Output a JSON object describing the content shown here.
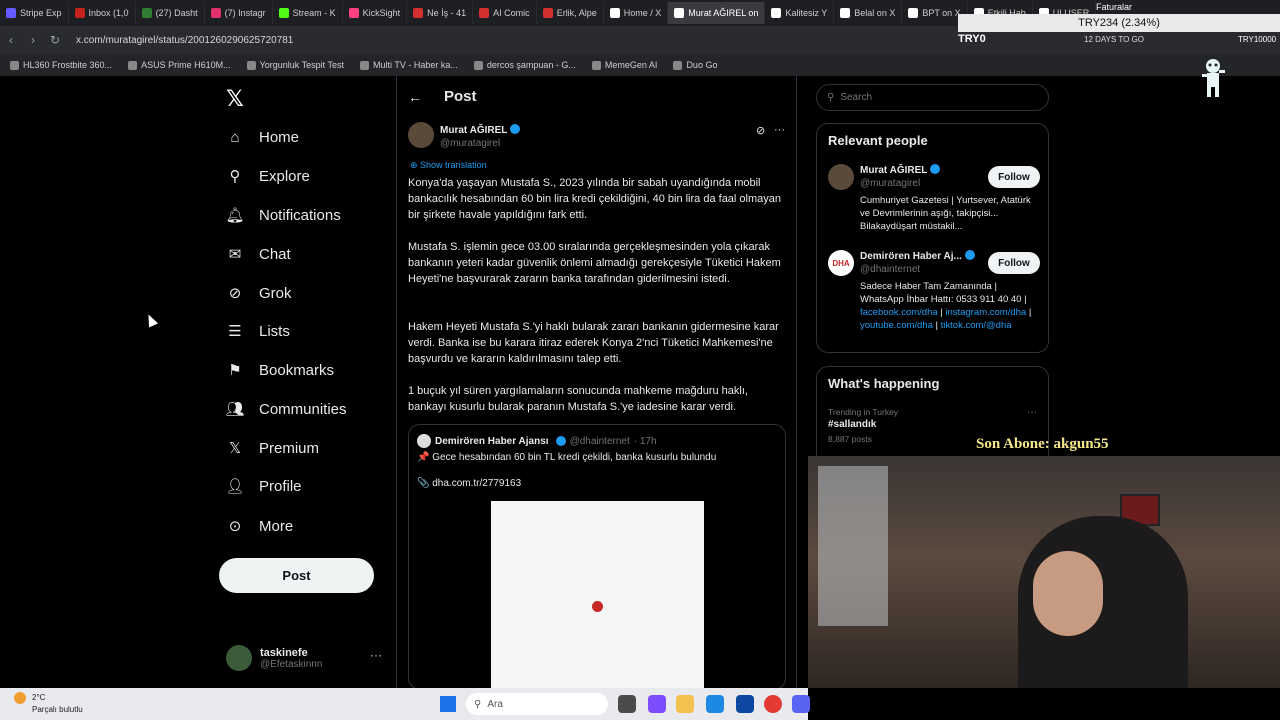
{
  "browser": {
    "tabs": [
      {
        "label": "Stripe Exp",
        "color": "#635bff"
      },
      {
        "label": "Inbox (1,0",
        "color": "#c5221f"
      },
      {
        "label": "(27) Dasht",
        "color": "#2e7d32"
      },
      {
        "label": "(7) Instagr",
        "color": "#e1306c"
      },
      {
        "label": "Stream - K",
        "color": "#53fc18"
      },
      {
        "label": "KickSight",
        "color": "#ff4081"
      },
      {
        "label": "Ne İş - 41",
        "color": "#d32f2f"
      },
      {
        "label": "AI Comic",
        "color": "#d32f2f"
      },
      {
        "label": "Erlik, Alpe",
        "color": "#d32f2f"
      },
      {
        "label": "Home / X",
        "color": "#ffffff"
      },
      {
        "label": "Murat AĞIREL on",
        "color": "#ffffff",
        "active": true
      },
      {
        "label": "Kalitesiz Y",
        "color": "#ffffff"
      },
      {
        "label": "Belal on X",
        "color": "#ffffff"
      },
      {
        "label": "BPT on X",
        "color": "#ffffff"
      },
      {
        "label": "Etkili Hab",
        "color": "#ffffff"
      },
      {
        "label": "ULUSER",
        "color": "#ffffff"
      }
    ],
    "url": "x.com/muratagirel/status/2001260290625720781",
    "bookmarks": [
      "HL360 Frostbite 360...",
      "ASUS Prime H610M...",
      "Yorgunluk Tespit Test",
      "Multi TV - Haber ka...",
      "dercos şampuan - G...",
      "MemeGen AI",
      "Duo Go"
    ]
  },
  "sidebar": {
    "items": [
      {
        "label": "Home"
      },
      {
        "label": "Explore"
      },
      {
        "label": "Notifications"
      },
      {
        "label": "Chat"
      },
      {
        "label": "Grok"
      },
      {
        "label": "Lists"
      },
      {
        "label": "Bookmarks"
      },
      {
        "label": "Communities"
      },
      {
        "label": "Premium"
      },
      {
        "label": "Profile"
      },
      {
        "label": "More"
      }
    ],
    "post_button": "Post",
    "account": {
      "name": "taskinefe",
      "handle": "@Efetaskinnn"
    }
  },
  "post": {
    "header": "Post",
    "author_name": "Murat AĞIREL",
    "author_handle": "@muratagirel",
    "show_translation": "Show translation",
    "paragraphs": [
      "Konya'da yaşayan Mustafa S., 2023 yılında bir sabah uyandığında mobil bankacılık hesabından 60 bin lira kredi çekildiğini, 40 bin lira da faal olmayan bir şirkete havale yapıldığını fark etti.",
      "Mustafa S. işlemin gece 03.00 sıralarında gerçekleşmesinden yola çıkarak bankanın yeteri kadar güvenlik önlemi almadığı gerekçesiyle Tüketici Hakem Heyeti'ne başvurarak zararın banka tarafından giderilmesini istedi.",
      "Hakem Heyeti Mustafa S.'yi haklı bularak zararı bankanın gidermesine karar verdi. Banka ise bu karara itiraz ederek Konya 2'nci Tüketici Mahkemesi'ne başvurdu ve kararın kaldırılmasını talep etti.",
      "1 buçuk yıl süren yargılamaların sonucunda mahkeme mağduru haklı, bankayı kusurlu bularak paranın Mustafa S.'ye iadesine karar verdi."
    ],
    "quote": {
      "name": "Demirören Haber Ajansı",
      "handle": "@dhainternet",
      "time": "· 17h",
      "line1": "📌 Gece hesabından 60 bin TL kredi çekildi, banka kusurlu bulundu",
      "line2": "📎 dha.com.tr/2779163"
    }
  },
  "right": {
    "search_placeholder": "Search",
    "relevant_title": "Relevant people",
    "people": [
      {
        "name": "Murat AĞIREL",
        "handle": "@muratagirel",
        "bio": "Cumhuriyet Gazetesi | Yurtsever, Atatürk ve Devrimlerinin aşığı, takipçisi... Bilakaydüşart müstakil...",
        "follow": "Follow"
      },
      {
        "name": "Demirören Haber Aj...",
        "handle": "@dhainternet",
        "bio_text": "Sadece Haber Tam Zamanında | WhatsApp İhbar Hattı: 0533 911 40 40 |",
        "links": [
          "facebook.com/dha",
          "instagram.com/dha",
          "youtube.com/dha",
          "tiktok.com/@dha"
        ],
        "follow": "Follow"
      }
    ],
    "happening_title": "What's happening",
    "trend": {
      "context": "Trending in Turkey",
      "tag": "#sallandık",
      "count": "8,887 posts"
    }
  },
  "overlay": {
    "try_banner": "TRY234 (2.34%)",
    "try_left": "TRY0",
    "try_days": "12 DAYS TO GO",
    "try_right": "TRY10000",
    "faturalar": "Faturalar",
    "son_abone": "Son Abone: akgun55"
  },
  "taskbar": {
    "weather_temp": "2°C",
    "weather_desc": "Parçalı bulutlu",
    "search_placeholder": "Ara"
  }
}
